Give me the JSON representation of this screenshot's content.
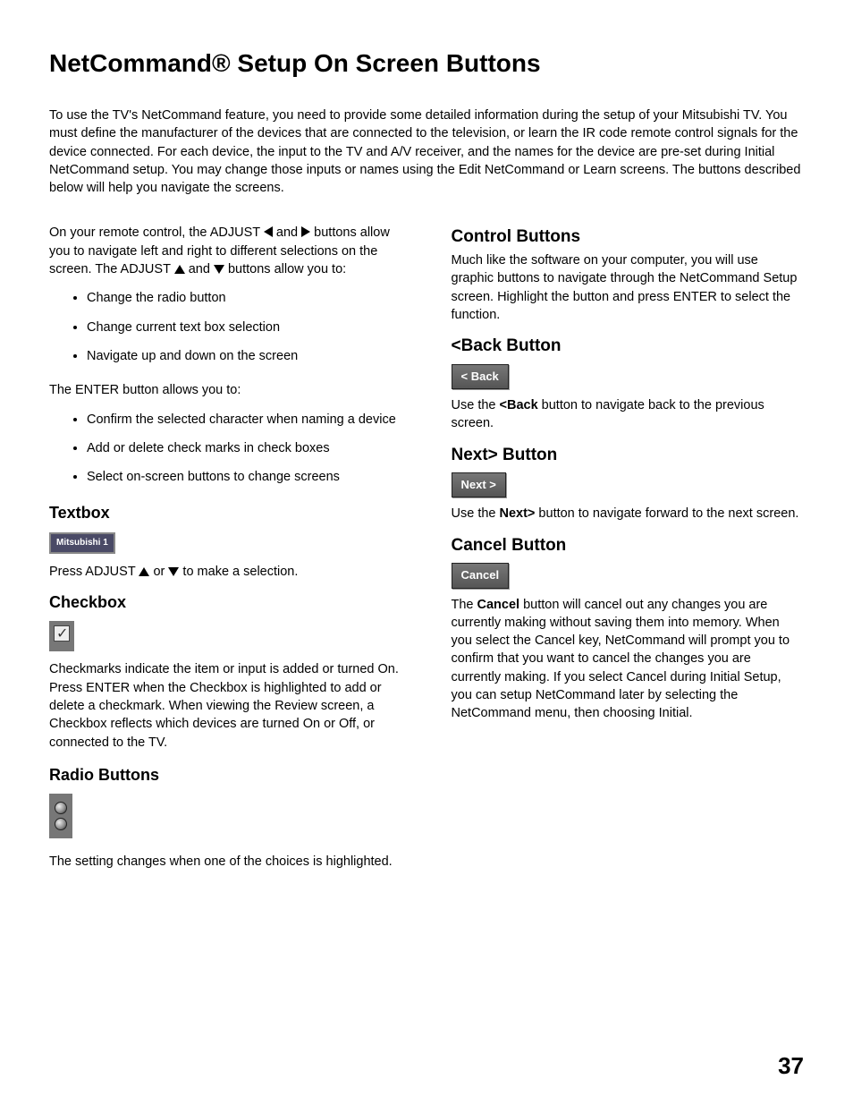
{
  "title": "NetCommand® Setup On Screen Buttons",
  "intro": "To use the TV's NetCommand feature, you need to provide some detailed information during the setup of your Mitsubishi TV.  You must define the manufacturer of the devices that are connected to the television, or learn the IR code remote control signals for the device connected.  For each device, the input to the TV and A/V receiver, and the names for the device are pre-set during Initial NetCommand setup.  You may change those inputs or names using the Edit NetCommand or Learn screens.  The buttons described below will help you navigate the screens.",
  "left": {
    "adjust_pre": "On your remote control, the ADJUST ",
    "adjust_mid1": " and ",
    "adjust_mid2": " buttons allow you to navigate left and right to different selections on the screen. The ADJUST ",
    "adjust_mid3": " and ",
    "adjust_post": " buttons allow you to:",
    "adjust_bullets": [
      "Change the radio button",
      "Change current text box selection",
      "Navigate up and down on the screen"
    ],
    "enter_lead": "The ENTER button allows you to:",
    "enter_bullets": [
      "Confirm the selected character when naming a device",
      "Add or delete check marks in check boxes",
      "Select on-screen buttons to change screens"
    ],
    "textbox_head": "Textbox",
    "textbox_value": "Mitsubishi 1",
    "textbox_desc_pre": "Press ADJUST ",
    "textbox_desc_mid": " or ",
    "textbox_desc_post": " to make a selection.",
    "checkbox_head": "Checkbox",
    "checkbox_desc": "Checkmarks indicate the item or input is added or turned On.  Press ENTER when the Checkbox is highlighted to add or delete a checkmark. When viewing the Review screen, a Checkbox reflects which devices are turned On or Off, or connected to the TV.",
    "radio_head": "Radio Buttons",
    "radio_desc": "The setting changes when one of the choices is highlighted."
  },
  "right": {
    "control_head": "Control Buttons",
    "control_desc": "Much like the software on your computer, you will use graphic buttons to navigate through the NetCommand Setup screen.  Highlight the button and press ENTER to select the function.",
    "back_head": "<Back Button",
    "back_label": "< Back",
    "back_desc_pre": "Use the ",
    "back_desc_bold": "<Back",
    "back_desc_post": " button to navigate back to the previous screen.",
    "next_head": "Next> Button",
    "next_label": "Next >",
    "next_desc_pre": "Use the ",
    "next_desc_bold": "Next>",
    "next_desc_post": " button to navigate forward to the next screen.",
    "cancel_head": "Cancel Button",
    "cancel_label": "Cancel",
    "cancel_desc_pre": "The ",
    "cancel_desc_bold": "Cancel",
    "cancel_desc_post": " button will cancel out any changes you are currently making without saving them into memory.  When you select the Cancel key, NetCommand will prompt you to confirm that you want to cancel the changes you are currently making.  If you select Cancel during Initial Setup, you can setup NetCommand later by selecting the NetCommand menu, then choosing Initial."
  },
  "page_number": "37"
}
